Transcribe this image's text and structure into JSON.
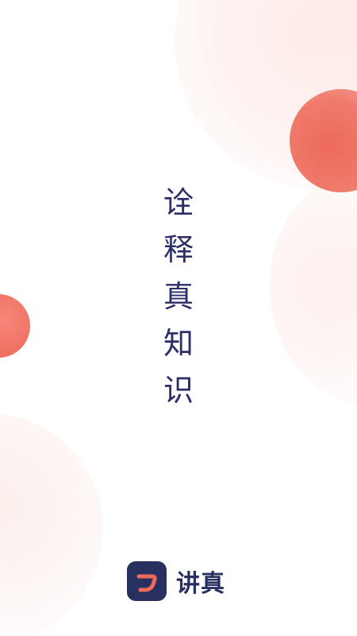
{
  "slogan": {
    "chars": [
      "诠",
      "释",
      "真",
      "知",
      "识"
    ]
  },
  "brand": {
    "name": "讲真",
    "icon": "brand-logo-icon"
  },
  "colors": {
    "text": "#2b2f66",
    "brand": "#283060",
    "accent": "#ee6a5a",
    "background": "#ffffff"
  }
}
